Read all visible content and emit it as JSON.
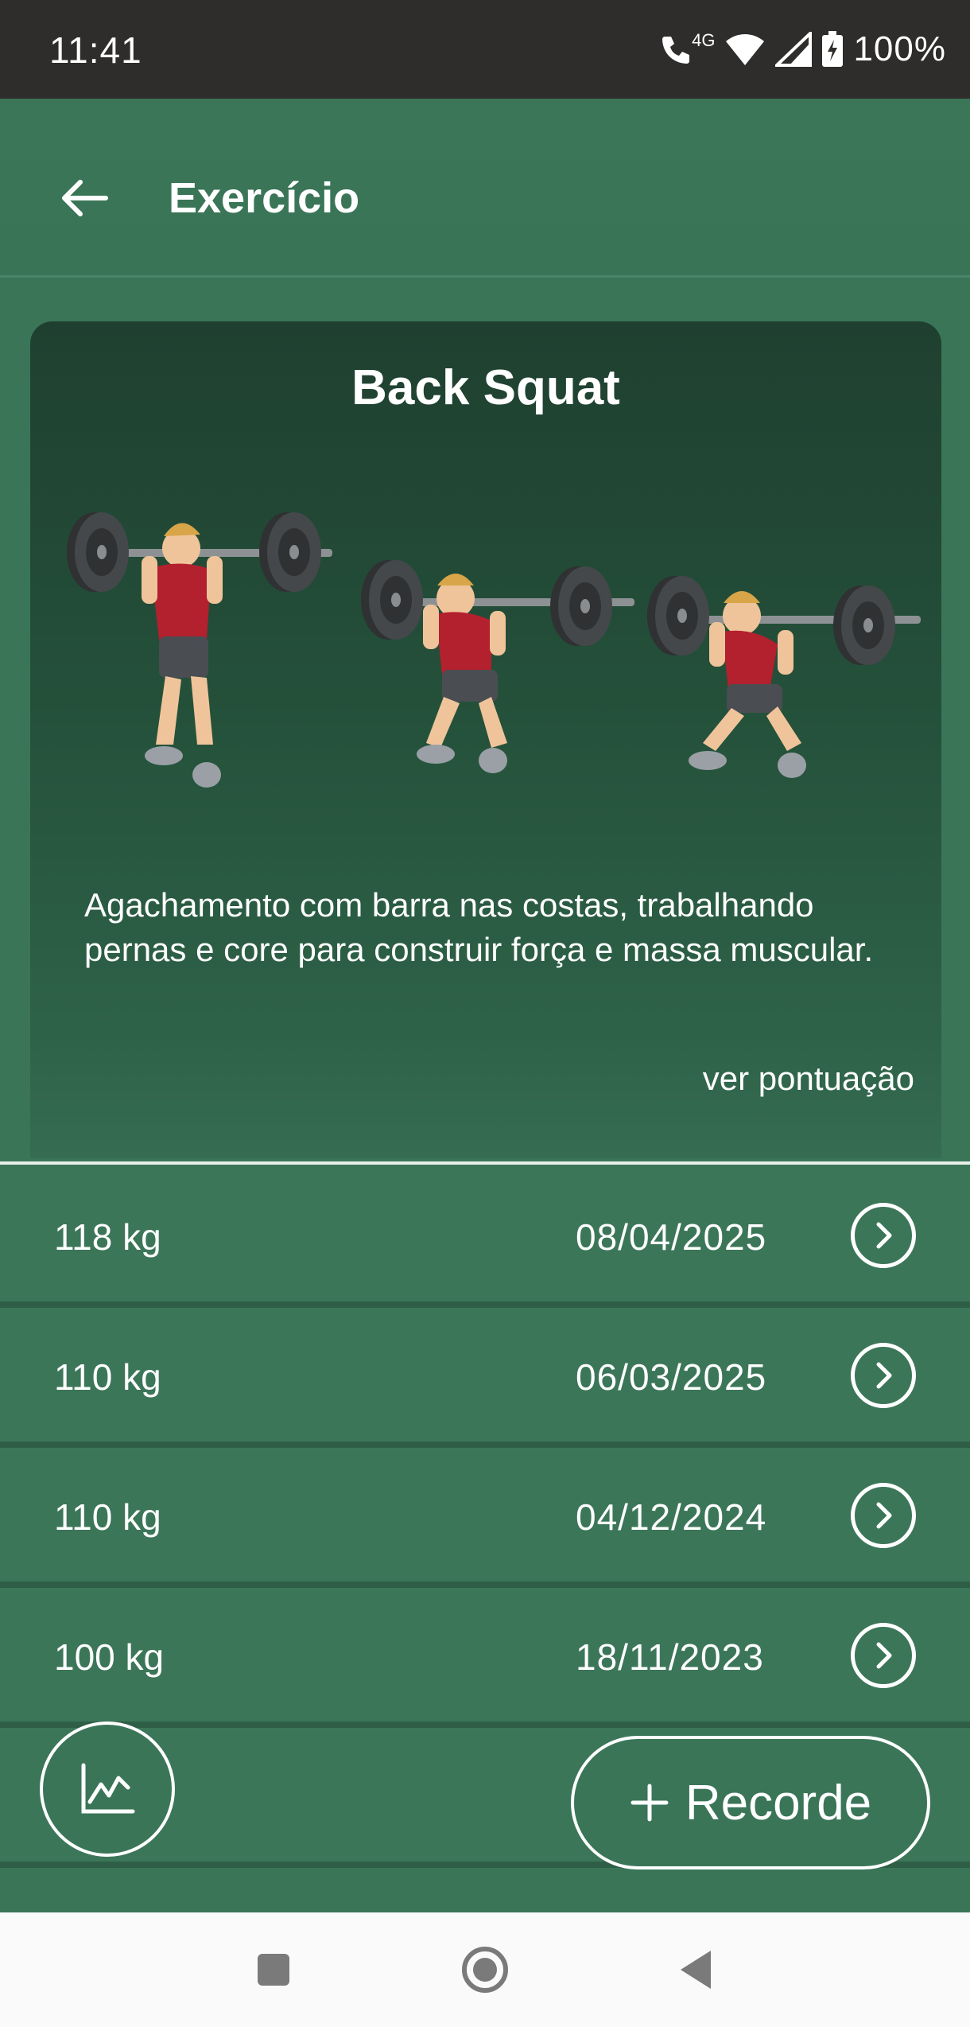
{
  "status_bar": {
    "time": "11:41",
    "network": "4G",
    "battery": "100%"
  },
  "header": {
    "title": "Exercício",
    "back_icon": "arrow-left-icon"
  },
  "exercise": {
    "name": "Back Squat",
    "description": "Agachamento com barra nas costas, trabalhando pernas e core para construir força e massa muscular.",
    "score_link": "ver pontuação"
  },
  "records": [
    {
      "weight": "118 kg",
      "date": "08/04/2025"
    },
    {
      "weight": "110 kg",
      "date": "06/03/2025"
    },
    {
      "weight": "110 kg",
      "date": "04/12/2024"
    },
    {
      "weight": "100 kg",
      "date": "18/11/2023"
    },
    {
      "weight": "",
      "date": ""
    }
  ],
  "actions": {
    "chart_icon": "line-chart-icon",
    "add_record_label": "Recorde",
    "add_record_icon": "plus-icon"
  },
  "colors": {
    "background": "#3a7558",
    "card_top": "#1f4030",
    "status_bar": "#2e2d2c",
    "shirt": "#b3202e"
  }
}
